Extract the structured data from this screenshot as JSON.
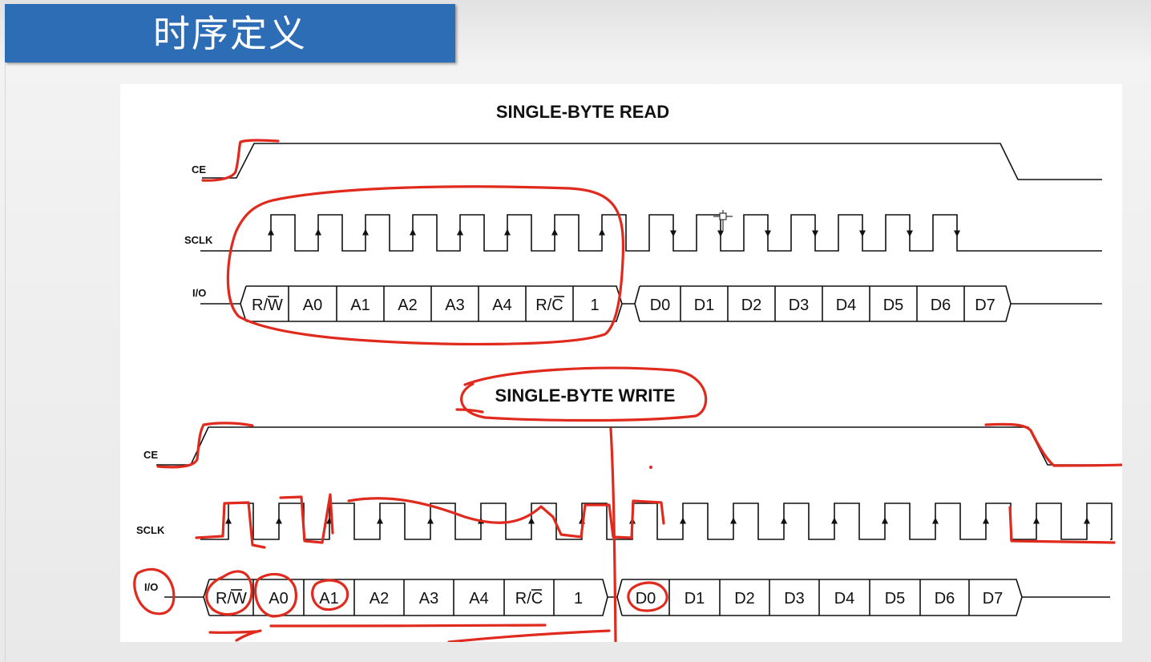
{
  "slide": {
    "title": "时序定义"
  },
  "read": {
    "title": "SINGLE-BYTE READ",
    "signals": {
      "ce": "CE",
      "sclk": "SCLK",
      "io": "I/O"
    },
    "command_cells": [
      "R/W",
      "A0",
      "A1",
      "A2",
      "A3",
      "A4",
      "R/C",
      "1"
    ],
    "data_cells": [
      "D0",
      "D1",
      "D2",
      "D3",
      "D4",
      "D5",
      "D6",
      "D7"
    ]
  },
  "write": {
    "title": "SINGLE-BYTE WRITE",
    "signals": {
      "ce": "CE",
      "sclk": "SCLK",
      "io": "I/O"
    },
    "command_cells": [
      "R/W",
      "A0",
      "A1",
      "A2",
      "A3",
      "A4",
      "R/C",
      "1"
    ],
    "data_cells": [
      "D0",
      "D1",
      "D2",
      "D3",
      "D4",
      "D5",
      "D6",
      "D7"
    ]
  },
  "colors": {
    "title_bar": "#2d6db5",
    "annotation": "#e02a1e",
    "ink": "#111111"
  }
}
